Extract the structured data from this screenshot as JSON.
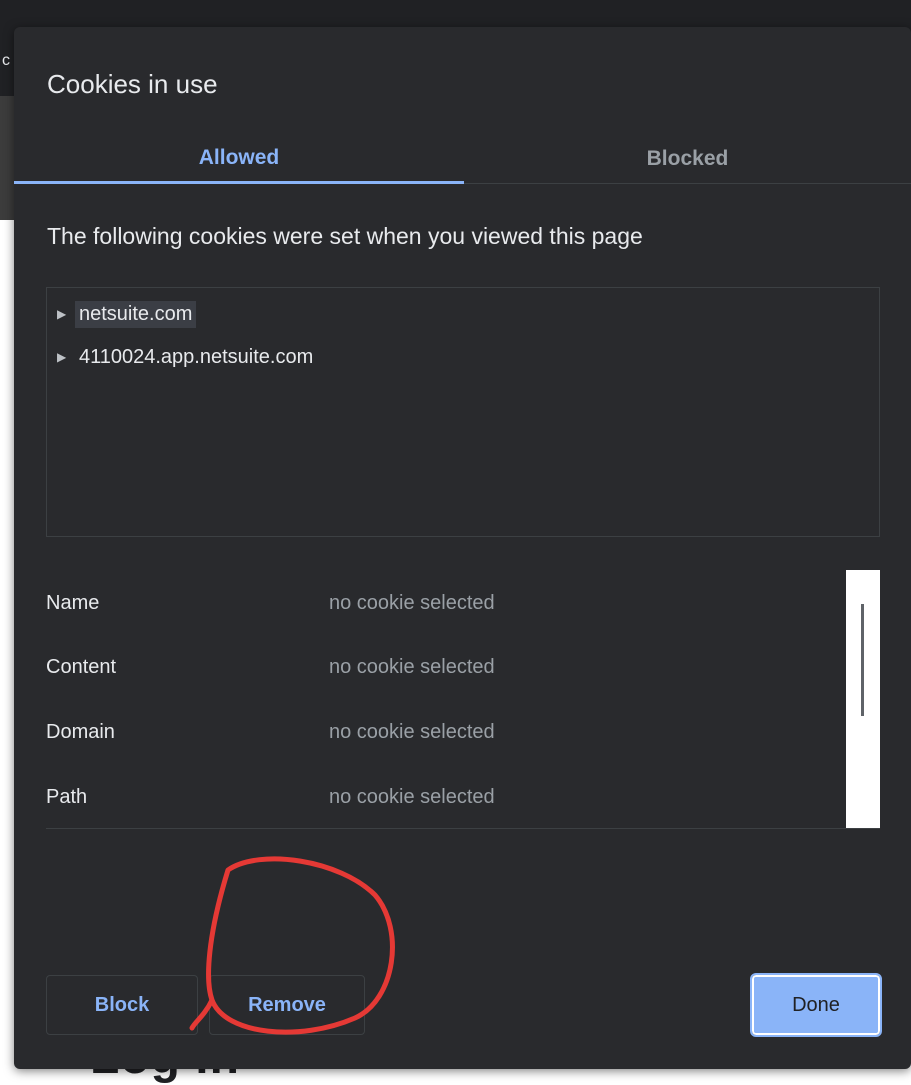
{
  "background": {
    "edge_char": "c",
    "page_heading": "Log in"
  },
  "dialog": {
    "title": "Cookies in use",
    "tabs": [
      {
        "label": "Allowed",
        "active": true
      },
      {
        "label": "Blocked",
        "active": false
      }
    ],
    "description": "The following cookies were set when you viewed this page",
    "tree": [
      {
        "label": "netsuite.com",
        "selected": true
      },
      {
        "label": "4110024.app.netsuite.com",
        "selected": false
      }
    ],
    "details": [
      {
        "key": "Name",
        "value": "no cookie selected"
      },
      {
        "key": "Content",
        "value": "no cookie selected"
      },
      {
        "key": "Domain",
        "value": "no cookie selected"
      },
      {
        "key": "Path",
        "value": "no cookie selected"
      }
    ],
    "buttons": {
      "block": "Block",
      "remove": "Remove",
      "done": "Done"
    }
  },
  "colors": {
    "dialog_bg": "#292a2d",
    "accent": "#8ab4f8",
    "annotation": "#e53935"
  }
}
